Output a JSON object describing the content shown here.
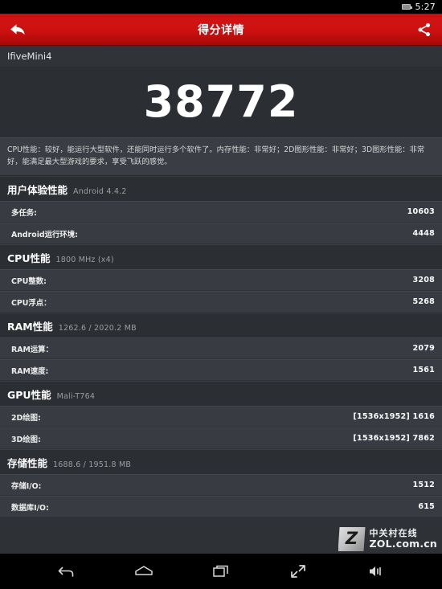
{
  "status_bar": {
    "time": "5:27",
    "battery_icon": "battery-icon"
  },
  "app_bar": {
    "title": "得分详情",
    "back_icon": "back-arrow-icon",
    "share_icon": "share-icon"
  },
  "device": {
    "name": "IfiveMini4"
  },
  "score": {
    "total": "38772"
  },
  "summary": {
    "text": "CPU性能：较好，能运行大型软件，还能同时运行多个软件了。内存性能：非常好；2D图形性能：非常好；3D图形性能：非常好，能满足最大型游戏的要求，享受飞跃的感觉。"
  },
  "sections": [
    {
      "title": "用户体验性能",
      "subtitle": "Android 4.4.2",
      "rows": [
        {
          "label": "多任务:",
          "value": "10603"
        },
        {
          "label": "Android运行环境:",
          "value": "4448"
        }
      ]
    },
    {
      "title": "CPU性能",
      "subtitle": "1800 MHz (x4)",
      "rows": [
        {
          "label": "CPU整数:",
          "value": "3208"
        },
        {
          "label": "CPU浮点：",
          "value": "5268"
        }
      ]
    },
    {
      "title": "RAM性能",
      "subtitle": "1262.6 / 2020.2 MB",
      "rows": [
        {
          "label": "RAM运算：",
          "value": "2079"
        },
        {
          "label": "RAM速度:",
          "value": "1561"
        }
      ]
    },
    {
      "title": "GPU性能",
      "subtitle": "Mali-T764",
      "rows": [
        {
          "label": "2D绘图:",
          "value": "[1536x1952] 1616"
        },
        {
          "label": "3D绘图:",
          "value": "[1536x1952] 7862"
        }
      ]
    },
    {
      "title": "存储性能",
      "subtitle": "1688.6 / 1951.8 MB",
      "rows": [
        {
          "label": "存储I/O:",
          "value": "1512"
        },
        {
          "label": "数据库I/O:",
          "value": "615"
        }
      ]
    }
  ],
  "nav_bar": {
    "buttons": [
      {
        "icon": "back-icon"
      },
      {
        "icon": "home-icon"
      },
      {
        "icon": "recents-icon"
      },
      {
        "icon": "fullscreen-icon"
      },
      {
        "icon": "volume-icon"
      }
    ]
  },
  "watermark": {
    "logo_letter": "Z",
    "name_cn": "中关村在线",
    "name_en": "ZOL.com.cn"
  },
  "colors": {
    "accent_red": "#cc1111",
    "page_bg": "#2e3136",
    "row_bg": "#383b41",
    "section_bg": "#2b2e33"
  }
}
